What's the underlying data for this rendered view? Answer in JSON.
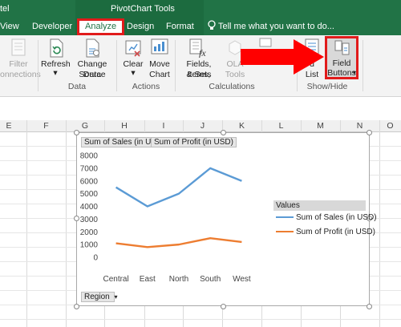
{
  "title_bar": {
    "app_title_fragment": "tel",
    "context_tool": "PivotChart Tools"
  },
  "tabs": [
    {
      "label": "View"
    },
    {
      "label": "Developer"
    },
    {
      "label": "Analyze",
      "active": true
    },
    {
      "label": "Design"
    },
    {
      "label": "Format"
    }
  ],
  "tell_me": "Tell me what you want to do...",
  "ribbon": {
    "filter": {
      "line1": "Filter",
      "line2": "onnections"
    },
    "refresh": "Refresh",
    "change_source": {
      "line1": "Change Data",
      "line2": "Source"
    },
    "clear": "Clear",
    "move_chart": {
      "line1": "Move",
      "line2": "Chart"
    },
    "fields_items": {
      "line1": "Fields, Items,",
      "line2": "& Sets"
    },
    "olap": {
      "line1": "OLA",
      "line2": "Tools"
    },
    "field_list": {
      "line1": "d",
      "line2": "List"
    },
    "field_buttons": {
      "line1": "Field",
      "line2": "Buttons"
    },
    "groups": {
      "data": "Data",
      "actions": "Actions",
      "calculations": "Calculations",
      "show_hide": "Show/Hide"
    }
  },
  "columns": [
    "E",
    "F",
    "G",
    "H",
    "I",
    "J",
    "K",
    "L",
    "M",
    "N",
    "O"
  ],
  "chart": {
    "field_buttons": {
      "values_sales": "Sum of Sales (in USD)",
      "values_profit": "Sum of Profit (in USD)",
      "axis_field": "Region"
    },
    "legend_title": "Values"
  },
  "chart_data": {
    "type": "line",
    "categories": [
      "Central",
      "East",
      "North",
      "South",
      "West"
    ],
    "series": [
      {
        "name": "Sum of Sales (in USD)",
        "values": [
          5500,
          4000,
          5000,
          7000,
          6000
        ],
        "color": "#5b9bd5"
      },
      {
        "name": "Sum of Profit (in USD)",
        "values": [
          1100,
          800,
          1000,
          1500,
          1200
        ],
        "color": "#ed7d31"
      }
    ],
    "ylim": [
      0,
      8000
    ],
    "yticks": [
      0,
      1000,
      2000,
      3000,
      4000,
      5000,
      6000,
      7000,
      8000
    ],
    "grid": false,
    "legend_position": "right"
  },
  "annotation": {
    "arrow_color": "#ff0000",
    "highlight_color": "#e11b1b"
  }
}
